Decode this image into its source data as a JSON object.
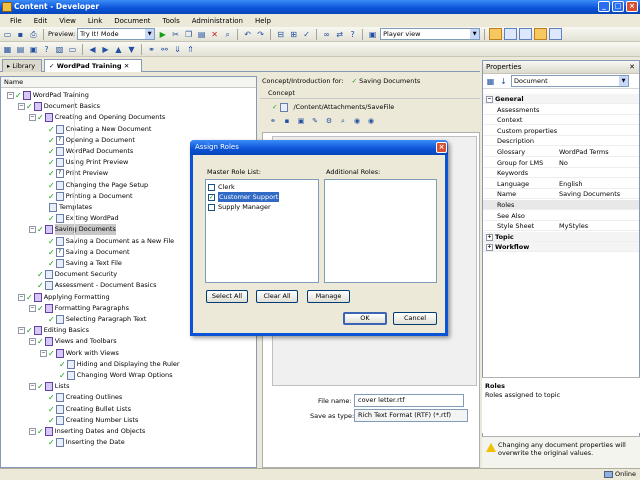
{
  "window": {
    "title": "Content - Developer"
  },
  "menu": [
    "File",
    "Edit",
    "View",
    "Link",
    "Document",
    "Tools",
    "Administration",
    "Help"
  ],
  "toolbar": {
    "preview_label": "Preview:",
    "preview_mode": "Try It! Mode",
    "player_view": "Player view"
  },
  "tabs": {
    "library": "Library",
    "project": "WordPad Training"
  },
  "tree": {
    "header": "Name",
    "items": [
      "WordPad Training",
      "Document Basics",
      "Creating and Opening Documents",
      "Creating a New Document",
      "Opening a Document",
      "WordPad Documents",
      "Using Print Preview",
      "Print Preview",
      "Changing the Page Setup",
      "Printing a Document",
      "Templates",
      "Exiting WordPad",
      "Saving Documents",
      "Saving a Document as a New File",
      "Saving a Document",
      "Saving a Text File",
      "Document Security",
      "Assessment - Document Basics",
      "Applying Formatting",
      "Formatting Paragraphs",
      "Selecting Paragraph Text",
      "Editing Basics",
      "Views and Toolbars",
      "Work with Views",
      "Hiding and Displaying the Ruler",
      "Changing Word Wrap Options",
      "Lists",
      "Creating Outlines",
      "Creating Bullet Lists",
      "Creating Number Lists",
      "Inserting Dates and Objects",
      "Inserting the Date"
    ]
  },
  "concept": {
    "header_label": "Concept/Introduction for:",
    "header_doc": "Saving Documents",
    "subheader": "Concept",
    "path": "/Content/Attachments/SaveFile",
    "file_name_label": "File name:",
    "file_name_value": "cover letter.rtf",
    "save_type_label": "Save as type:",
    "save_type_value": "Rich Text Format (RTF) (*.rtf)"
  },
  "properties": {
    "title": "Properties",
    "selector": "Document",
    "general_label": "General",
    "rows": [
      {
        "k": "Assessments",
        "v": ""
      },
      {
        "k": "Context",
        "v": ""
      },
      {
        "k": "Custom properties",
        "v": ""
      },
      {
        "k": "Description",
        "v": ""
      },
      {
        "k": "Glossary",
        "v": "WordPad Terms"
      },
      {
        "k": "Group for LMS",
        "v": "No"
      },
      {
        "k": "Keywords",
        "v": ""
      },
      {
        "k": "Language",
        "v": "English"
      },
      {
        "k": "Name",
        "v": "Saving Documents"
      },
      {
        "k": "Roles",
        "v": ""
      },
      {
        "k": "See Also",
        "v": ""
      },
      {
        "k": "Style Sheet",
        "v": "MyStyles"
      }
    ],
    "topic_label": "Topic",
    "workflow_label": "Workflow",
    "desc_title": "Roles",
    "desc_text": "Roles assigned to topic",
    "warning": "Changing any document properties will overwrite the original values."
  },
  "dialog": {
    "title": "Assign Roles",
    "master_label": "Master Role List:",
    "additional_label": "Additional Roles:",
    "roles": [
      {
        "name": "Clerk",
        "checked": false
      },
      {
        "name": "Customer Support",
        "checked": true
      },
      {
        "name": "Supply Manager",
        "checked": false
      }
    ],
    "select_all": "Select All",
    "clear_all": "Clear All",
    "manage": "Manage",
    "ok": "OK",
    "cancel": "Cancel"
  },
  "status": {
    "online": "Online"
  }
}
